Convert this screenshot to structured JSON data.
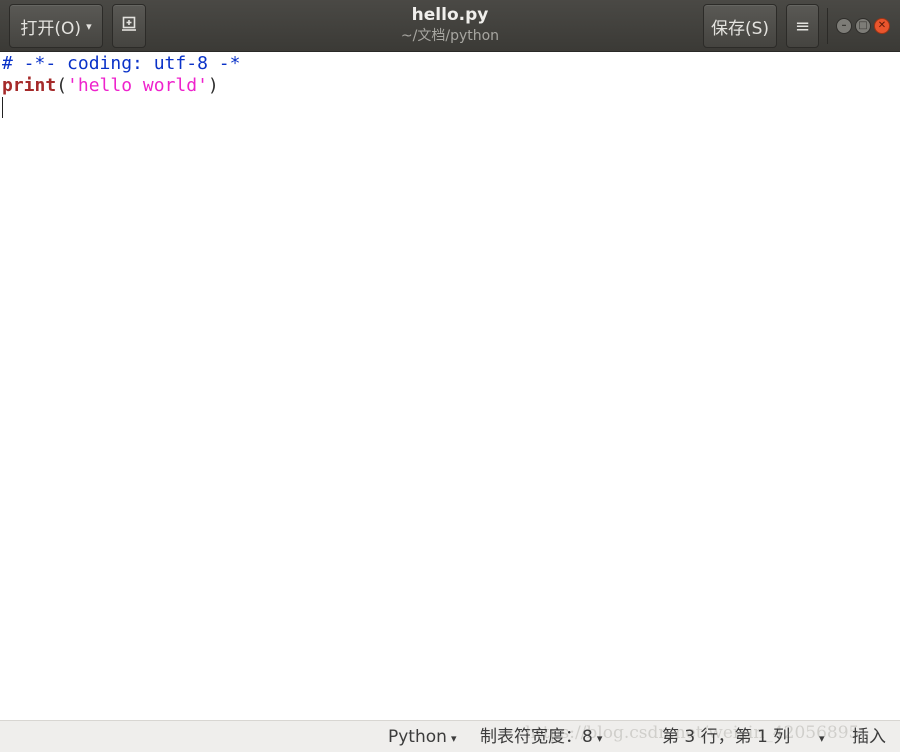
{
  "window": {
    "title": "hello.py",
    "path": "~/文档/python",
    "controls": {
      "minimize_icon": "minimize-icon",
      "maximize_icon": "maximize-icon",
      "close_icon": "close-icon"
    }
  },
  "toolbar": {
    "open_label": "打开(O)",
    "open_caret": "▾",
    "new_doc_icon": "new-document-icon",
    "save_label": "保存(S)",
    "menu_icon": "≡"
  },
  "editor": {
    "lines": [
      {
        "text": "# -*- coding: utf-8 -*"
      },
      {
        "kw": "print",
        "open": "(",
        "str": "'hello world'",
        "close": ")"
      }
    ]
  },
  "statusbar": {
    "language": "Python",
    "tab_width_label": "制表符宽度：",
    "tab_width_value": "8",
    "position": "第 3 行，第 1 列",
    "mode": "插入",
    "dropdown_caret": "▾"
  },
  "watermark": "https://blog.csdn.net/weixin_42056895",
  "colors": {
    "comment": "#0a32c8",
    "keyword": "#a52a2a",
    "string": "#ee22cc",
    "close": "#e9552d"
  }
}
